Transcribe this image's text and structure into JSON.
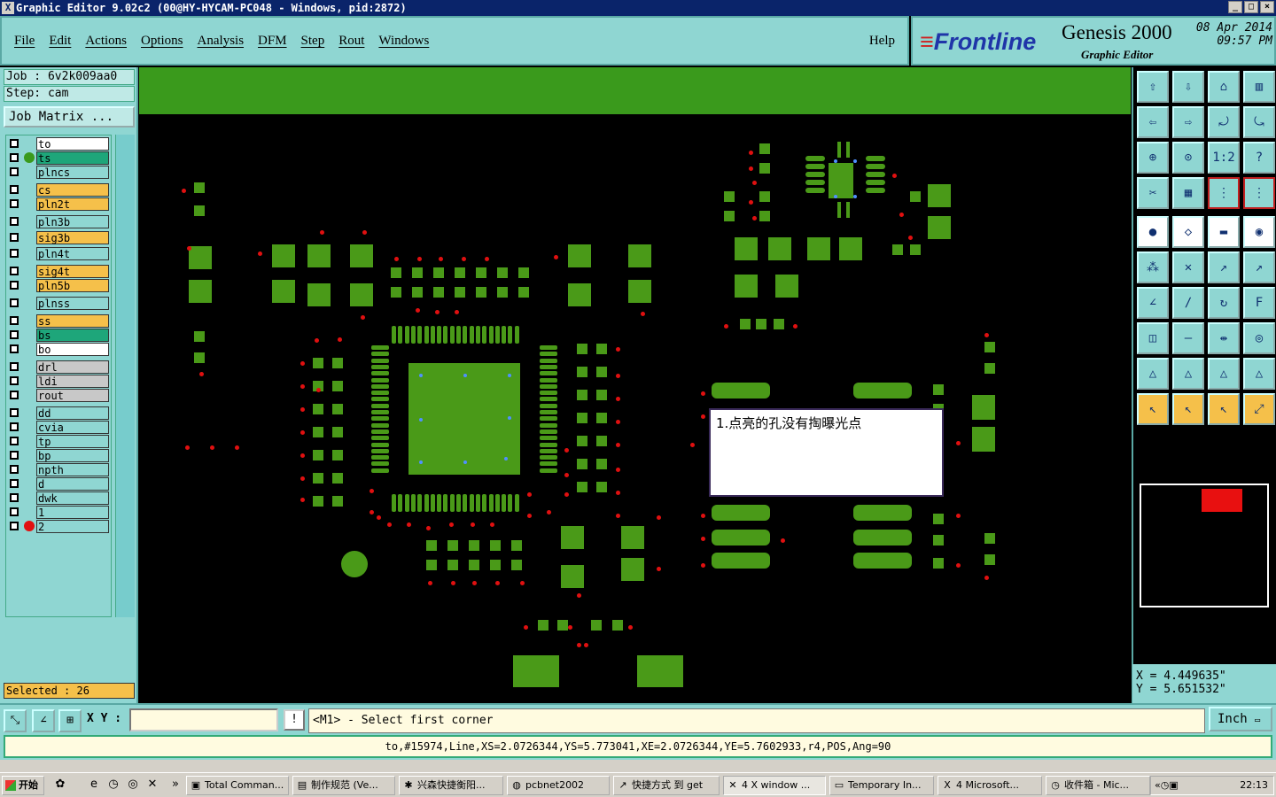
{
  "window": {
    "title": "Graphic Editor 9.02c2 (00@HY-HYCAM-PC048 - Windows, pid:2872)",
    "controls": [
      "_",
      "□",
      "×"
    ]
  },
  "menu": {
    "items": [
      "File",
      "Edit",
      "Actions",
      "Options",
      "Analysis",
      "DFM",
      "Step",
      "Rout",
      "Windows"
    ],
    "help": "Help"
  },
  "brand": {
    "logo": "Frontline",
    "product": "Genesis 2000",
    "subtitle": "Graphic Editor",
    "date": "08 Apr 2014",
    "time": "09:57 PM"
  },
  "job": {
    "job_line": "Job : 6v2k009aa0",
    "step_line": "Step: cam",
    "matrix_button": "Job Matrix ..."
  },
  "layers": [
    {
      "name": "to",
      "color": "#ffffff",
      "dot": ""
    },
    {
      "name": "ts",
      "color": "#1ea67a",
      "dot": "#3a9a1c"
    },
    {
      "name": "plncs",
      "color": "#8fd6d2",
      "dot": ""
    },
    {
      "name": "cs",
      "color": "#f5c04a",
      "dot": ""
    },
    {
      "name": "pln2t",
      "color": "#f5c04a",
      "dot": ""
    },
    {
      "name": "pln3b",
      "color": "#8fd6d2",
      "dot": ""
    },
    {
      "name": "sig3b",
      "color": "#f5c04a",
      "dot": ""
    },
    {
      "name": "pln4t",
      "color": "#8fd6d2",
      "dot": ""
    },
    {
      "name": "sig4t",
      "color": "#f5c04a",
      "dot": ""
    },
    {
      "name": "pln5b",
      "color": "#f5c04a",
      "dot": ""
    },
    {
      "name": "plnss",
      "color": "#8fd6d2",
      "dot": ""
    },
    {
      "name": "ss",
      "color": "#f5c04a",
      "dot": ""
    },
    {
      "name": "bs",
      "color": "#1ea67a",
      "dot": ""
    },
    {
      "name": "bo",
      "color": "#ffffff",
      "dot": ""
    },
    {
      "name": "drl",
      "color": "#c8c8c8",
      "dot": ""
    },
    {
      "name": "ldi",
      "color": "#c8c8c8",
      "dot": ""
    },
    {
      "name": "rout",
      "color": "#c8c8c8",
      "dot": ""
    },
    {
      "name": "dd",
      "color": "#8fd6d2",
      "dot": ""
    },
    {
      "name": "cvia",
      "color": "#8fd6d2",
      "dot": ""
    },
    {
      "name": "tp",
      "color": "#8fd6d2",
      "dot": ""
    },
    {
      "name": "bp",
      "color": "#8fd6d2",
      "dot": ""
    },
    {
      "name": "npth",
      "color": "#8fd6d2",
      "dot": ""
    },
    {
      "name": "d",
      "color": "#8fd6d2",
      "dot": ""
    },
    {
      "name": "dwk",
      "color": "#8fd6d2",
      "dot": ""
    },
    {
      "name": "1",
      "color": "#8fd6d2",
      "dot": ""
    },
    {
      "name": "2",
      "color": "#8fd6d2",
      "dot": "#e01010"
    }
  ],
  "selected": "Selected : 26",
  "popup": {
    "text": "1.点亮的孔没有掏曝光点"
  },
  "coords": {
    "x": "X = 4.449635\"",
    "y": "Y = 5.651532\""
  },
  "command": {
    "xy_label": "X Y :",
    "xy_value": "",
    "bang": "!",
    "prompt": "<M1> - Select first corner",
    "unit": "Inch"
  },
  "status_line": "to,#15974,Line,XS=2.0726344,YS=5.773041,XE=2.0726344,YE=5.7602933,r4,POS,Ang=90",
  "taskbar": {
    "start": "开始",
    "tasks": [
      {
        "label": "Total Comman...",
        "icon": "floppy-icon"
      },
      {
        "label": "制作规范 (Ve...",
        "icon": "document-icon"
      },
      {
        "label": "兴森快捷衡阳...",
        "icon": "star-icon"
      },
      {
        "label": "pcbnet2002",
        "icon": "globe-icon"
      },
      {
        "label": "快捷方式 到 get",
        "icon": "shortcut-icon"
      },
      {
        "label": "4 X window ...",
        "icon": "x-icon"
      },
      {
        "label": "Temporary In...",
        "icon": "folder-icon"
      },
      {
        "label": "4 Microsoft...",
        "icon": "excel-icon"
      },
      {
        "label": "收件箱 - Mic...",
        "icon": "mail-icon"
      }
    ],
    "clock": "22:13"
  }
}
